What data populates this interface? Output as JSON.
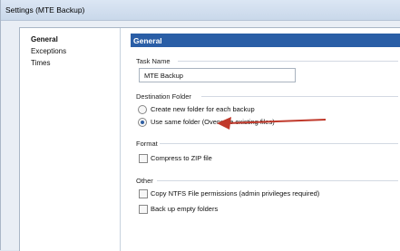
{
  "window": {
    "title": "Settings (MTE Backup)"
  },
  "sidebar": {
    "items": [
      {
        "label": "General",
        "active": true
      },
      {
        "label": "Exceptions",
        "active": false
      },
      {
        "label": "Times",
        "active": false
      }
    ]
  },
  "panel": {
    "header": "General",
    "task_name": {
      "label": "Task Name",
      "value": "MTE Backup"
    },
    "destination": {
      "label": "Destination Folder",
      "options": [
        {
          "label": "Create new folder for each backup",
          "selected": false
        },
        {
          "label": "Use same folder (Overwrite existing files)",
          "selected": true
        }
      ]
    },
    "format": {
      "label": "Format",
      "compress_label": "Compress to ZIP file",
      "compress_checked": false
    },
    "other": {
      "label": "Other",
      "ntfs_label": "Copy NTFS File permissions (admin privileges required)",
      "ntfs_checked": false,
      "empty_folders_label": "Back up empty folders",
      "empty_folders_checked": false
    }
  },
  "annotation": {
    "arrow_color": "#c0392b",
    "arrow_icon": "left-arrow-icon"
  }
}
